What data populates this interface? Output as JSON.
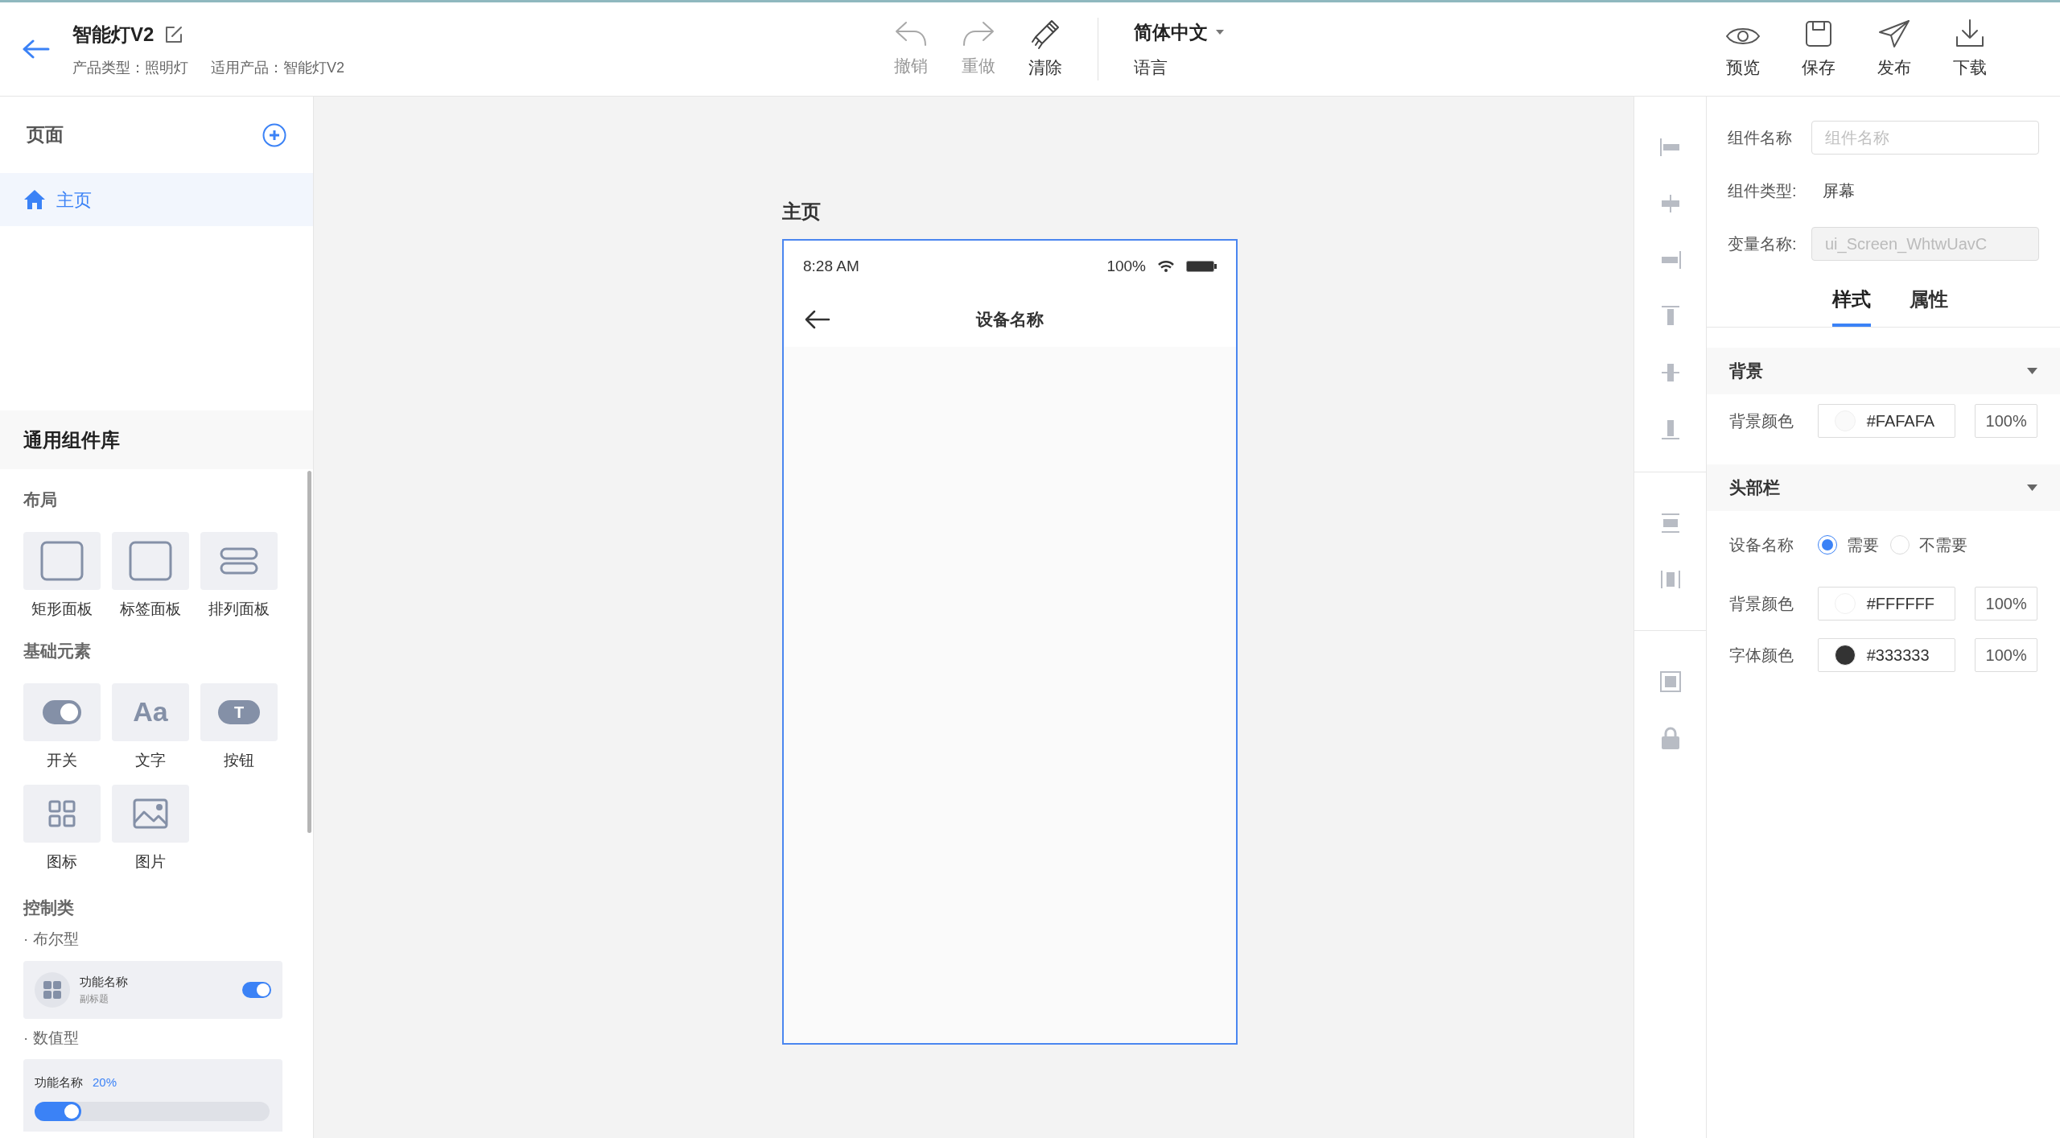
{
  "header": {
    "title": "智能灯V2",
    "meta": [
      "产品类型：照明灯",
      "适用产品：智能灯V2"
    ]
  },
  "toolbar": [
    {
      "label": "撤销",
      "kind": "undo",
      "disabled": true
    },
    {
      "label": "重做",
      "kind": "redo",
      "disabled": true
    },
    {
      "label": "清除",
      "kind": "clear",
      "disabled": false
    }
  ],
  "language": {
    "value": "简体中文",
    "label": "语言"
  },
  "actions": [
    {
      "label": "预览",
      "kind": "preview"
    },
    {
      "label": "保存",
      "kind": "save"
    },
    {
      "label": "发布",
      "kind": "publish"
    },
    {
      "label": "下载",
      "kind": "download"
    }
  ],
  "pages": {
    "title": "页面",
    "items": [
      {
        "label": "主页",
        "selected": true
      }
    ]
  },
  "library": {
    "title": "通用组件库",
    "groups": [
      {
        "title": "布局",
        "items": [
          {
            "label": "矩形面板",
            "kind": "rect"
          },
          {
            "label": "标签面板",
            "kind": "rect"
          },
          {
            "label": "排列面板",
            "kind": "rows"
          }
        ]
      },
      {
        "title": "基础元素",
        "items": [
          {
            "label": "开关",
            "kind": "switch"
          },
          {
            "label": "文字",
            "kind": "text",
            "glyph": "Aa"
          },
          {
            "label": "按钮",
            "kind": "button",
            "glyph": "T"
          },
          {
            "label": "图标",
            "kind": "grid"
          },
          {
            "label": "图片",
            "kind": "image"
          }
        ]
      }
    ]
  },
  "controls": {
    "title": "控制类",
    "sections": [
      {
        "label": "· 布尔型",
        "kind": "bool",
        "name": "功能名称",
        "subtitle": "副标题",
        "on": true
      },
      {
        "label": "· 数值型",
        "kind": "number",
        "name": "功能名称",
        "value": "20%",
        "level": 0.2
      }
    ]
  },
  "canvas": {
    "page_title": "主页",
    "phone": {
      "time": "8:28 AM",
      "battery": "100%",
      "title": "设备名称"
    }
  },
  "props": {
    "name_label": "组件名称",
    "name_placeholder": "组件名称",
    "type_label": "组件类型:",
    "type_value": "屏幕",
    "var_label": "变量名称:",
    "var_value": "ui_Screen_WhtwUavC",
    "tabs": [
      {
        "label": "样式",
        "selected": true
      },
      {
        "label": "属性",
        "selected": false
      }
    ],
    "sections": [
      {
        "title": "背景",
        "rows": [
          {
            "kind": "color",
            "label": "背景颜色",
            "color": "#fafafa",
            "value": "#FAFAFA",
            "opacity": "100%"
          }
        ]
      },
      {
        "title": "头部栏",
        "rows": [
          {
            "kind": "radio",
            "label": "设备名称",
            "options": [
              {
                "label": "需要",
                "selected": true
              },
              {
                "label": "不需要",
                "selected": false
              }
            ]
          },
          {
            "kind": "color",
            "label": "背景颜色",
            "color": "#ffffff",
            "value": "#FFFFFF",
            "opacity": "100%"
          },
          {
            "kind": "color",
            "label": "字体颜色",
            "color": "#333333",
            "value": "#333333",
            "opacity": "100%"
          }
        ]
      }
    ]
  }
}
